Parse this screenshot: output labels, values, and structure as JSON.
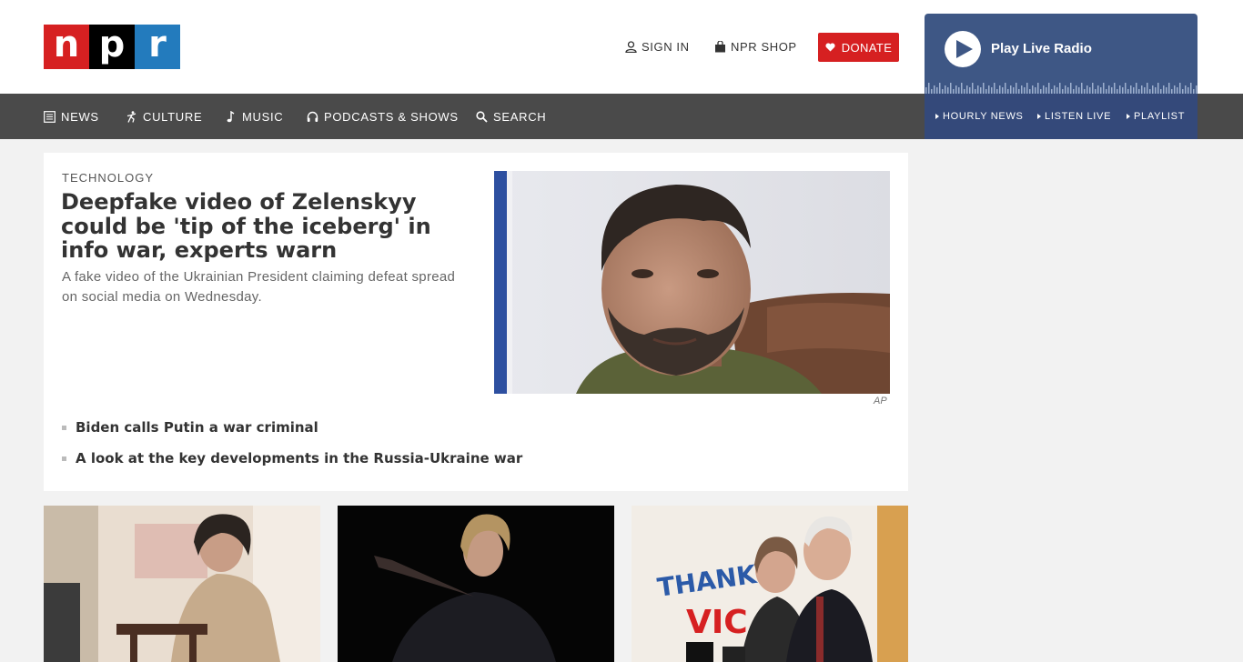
{
  "header": {
    "logo": {
      "letters": [
        "n",
        "p",
        "r"
      ],
      "colors": [
        "#d62021",
        "#000000",
        "#237bbd"
      ]
    },
    "sign_in": "SIGN IN",
    "shop": "NPR SHOP",
    "donate": "DONATE",
    "icons": [
      "user-icon",
      "shopping-bag-icon",
      "heart-icon"
    ]
  },
  "nav": {
    "items": [
      {
        "label": "NEWS",
        "icon": "newspaper-icon"
      },
      {
        "label": "CULTURE",
        "icon": "dancer-icon"
      },
      {
        "label": "MUSIC",
        "icon": "music-note-icon"
      },
      {
        "label": "PODCASTS & SHOWS",
        "icon": "headphones-icon"
      },
      {
        "label": "SEARCH",
        "icon": "search-icon"
      }
    ],
    "background": "#4a4a4a"
  },
  "player": {
    "label": "Play Live Radio",
    "links": [
      "HOURLY NEWS",
      "LISTEN LIVE",
      "PLAYLIST"
    ],
    "background": "#3e5785"
  },
  "lead_story": {
    "slug": "TECHNOLOGY",
    "headline": "Deepfake video of Zelenskyy could be 'tip of the iceberg' in info war, experts warn",
    "teaser": "A fake video of the Ukrainian President claiming defeat spread on social media on Wednesday.",
    "image_credit": "AP",
    "related": [
      "Biden calls Putin a war criminal",
      "A look at the key developments in the Russia-Ukraine war"
    ]
  },
  "colors": {
    "brand_red": "#d62021",
    "brand_blue": "#237bbd",
    "page_bg": "#f2f2f2"
  }
}
